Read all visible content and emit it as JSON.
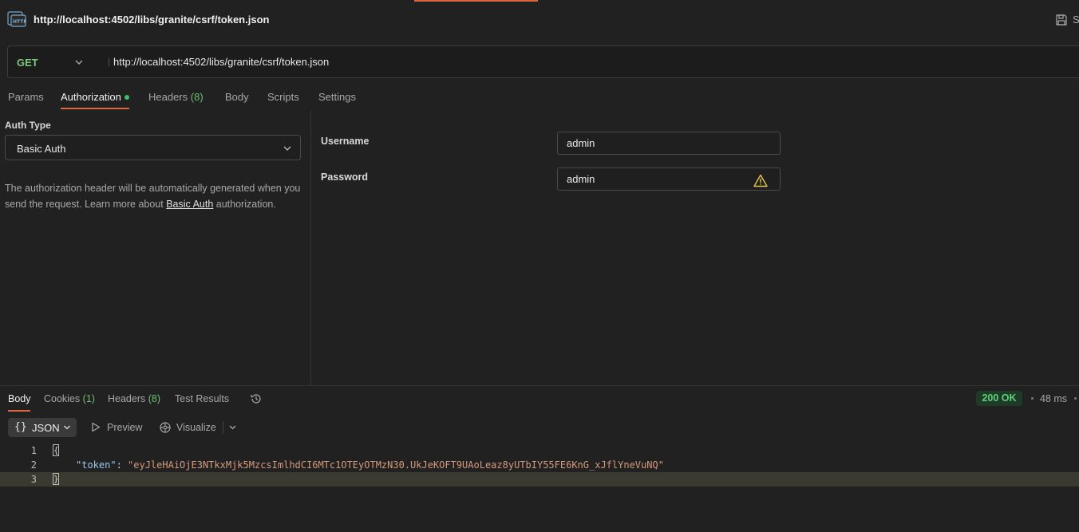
{
  "title": {
    "url": "http://localhost:4502/libs/granite/csrf/token.json",
    "save_label": "S"
  },
  "request": {
    "method": "GET",
    "url": "http://localhost:4502/libs/granite/csrf/token.json"
  },
  "tabs": {
    "params": "Params",
    "authorization": "Authorization",
    "headers": "Headers",
    "headers_count": "(8)",
    "body": "Body",
    "scripts": "Scripts",
    "settings": "Settings"
  },
  "auth": {
    "type_label": "Auth Type",
    "type_value": "Basic Auth",
    "desc_1": "The authorization header will be automatically generated when you send the request. Learn more about ",
    "desc_link": "Basic Auth",
    "desc_2": " authorization.",
    "username_label": "Username",
    "username_value": "admin",
    "password_label": "Password",
    "password_value": "admin"
  },
  "response": {
    "tabs": {
      "body": "Body",
      "cookies": "Cookies",
      "cookies_count": "(1)",
      "headers": "Headers",
      "headers_count": "(8)",
      "test_results": "Test Results"
    },
    "status": "200 OK",
    "time": "48 ms",
    "format": "JSON",
    "preview": "Preview",
    "visualize": "Visualize",
    "lines": [
      "1",
      "2",
      "3"
    ],
    "json_key": "\"token\"",
    "json_value": "\"eyJleHAiOjE3NTkxMjk5MzcsImlhdCI6MTc1OTEyOTMzN30.UkJeKOFT9UAoLeaz8yUTbIY55FE6KnG_xJflYneVuNQ\""
  },
  "colors": {
    "accent": "#e0653f",
    "method_get": "#7ec87e",
    "status_ok": "#5fd07a"
  }
}
